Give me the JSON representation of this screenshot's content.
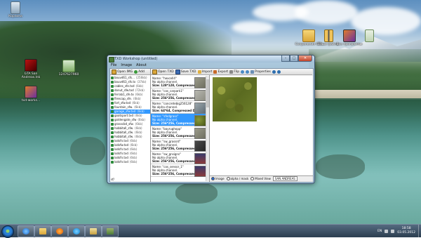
{
  "desktop": {
    "icons": [
      {
        "id": "recycle-bin",
        "label": "Корзина",
        "icon": "recycle-bin-icon"
      },
      {
        "id": "gta-sa",
        "label": "GTA San Andreas.lnk",
        "icon": "gta-icon"
      },
      {
        "id": "folder-1",
        "label": "1247627960",
        "icon": "image-file-icon"
      },
      {
        "id": "txd-works",
        "label": "txd-works...",
        "icon": "app-icon"
      },
      {
        "id": "rar-1",
        "label": "Сохранения GTA",
        "icon": "folder-icon"
      },
      {
        "id": "rar-2",
        "label": "Ваши файлы",
        "icon": "zip-icon"
      },
      {
        "id": "tool-1",
        "label": "Все программы",
        "icon": "tools-icon"
      },
      {
        "id": "doc-1",
        "label": "",
        "icon": "document-icon"
      }
    ]
  },
  "window": {
    "title": "TXD Workshop (untitled)",
    "menu": [
      "File",
      "Image",
      "About"
    ],
    "file_toolbar": {
      "open": "Open IMG",
      "add": "Add"
    },
    "tex_toolbar": {
      "open": "Open TXD",
      "save": "Save TXD",
      "import": "Import",
      "export": "Export",
      "flip": "Flip",
      "properties": "Properties"
    },
    "files": [
      {
        "name": "bouvd61_sfs...",
        "size": "(256kb)"
      },
      {
        "name": "bouvd63_sfs.tx",
        "size": "(37kb)"
      },
      {
        "name": "cables_sfe.txd",
        "size": "(6kb)"
      },
      {
        "name": "donut_sfw.txd",
        "size": "(72kb)"
      },
      {
        "name": "ferrab1_sfe.tx",
        "size": "(6kb)"
      },
      {
        "name": "firescap_sfe.",
        "size": "(6kb)"
      },
      {
        "name": "fort_sfw.txd",
        "size": "(6kb)"
      },
      {
        "name": "fountain_sfw.",
        "size": "(6kb)"
      },
      {
        "name": "garage_sfw.txd",
        "size": "(6kb)"
      },
      {
        "name": "goatsport.txd",
        "size": "(6kb)"
      },
      {
        "name": "goldengate_sfw",
        "size": "(6kb)"
      },
      {
        "name": "grasscbd_sfw.",
        "size": "(6kb)"
      },
      {
        "name": "hobbitall_sfw.",
        "size": "(6kb)"
      },
      {
        "name": "hobbitall_sfw.",
        "size": "(6kb)"
      },
      {
        "name": "hobbitall_sfw.",
        "size": "(6kb)"
      },
      {
        "name": "lodsfn.txd",
        "size": "(6kb)"
      },
      {
        "name": "lodsfw.txd",
        "size": "(6kb)"
      },
      {
        "name": "lodsfn.txd",
        "size": "(6kb)"
      },
      {
        "name": "lodsfn.txd",
        "size": "(6kb)"
      },
      {
        "name": "lodsfn.txd",
        "size": "(6kb)"
      },
      {
        "name": "lodsfn.txd",
        "size": "(6kb)"
      }
    ],
    "selected_file_index": 8,
    "status_left": "sf/",
    "textures": [
      {
        "name": "Name: \"hexcell4\"",
        "alpha": "No alpha channel.",
        "size": "Size: 128*128, Compressed",
        "thumb": "stone"
      },
      {
        "name": "Name: \"cos_carpark1\"",
        "alpha": "No alpha channel.",
        "size": "Size: 256*256, Compressed",
        "thumb": "light"
      },
      {
        "name": "Name: \"concretebig256128\"",
        "alpha": "No alpha channel.",
        "size": "Size: 64*64, Compressed DX",
        "thumb": "grey"
      },
      {
        "name": "Name: \"sfedgrass\"",
        "alpha": "No alpha channel.",
        "size": "Size: 256*256, Compressed",
        "thumb": "grass"
      },
      {
        "name": "Name: \"bayrughopp\"",
        "alpha": "No alpha channel.",
        "size": "Size: 256*256, Compressed",
        "thumb": "stone"
      },
      {
        "name": "Name: \"sw_grassrd\"",
        "alpha": "No alpha channel.",
        "size": "Size: 256*256, Compressed",
        "thumb": "dark"
      },
      {
        "name": "Name: \"sw_gnsigns\"",
        "alpha": "No alpha channel.",
        "size": "Size: 256*256, Compressed",
        "thumb": "pic"
      },
      {
        "name": "Name: \"cos_sensor_1\"",
        "alpha": "No alpha channel.",
        "size": "Size: 256*256, Compressed",
        "thumb": "pic"
      }
    ],
    "selected_texture_index": 3,
    "view_options": {
      "image": "Image",
      "alpha": "alpha / mask",
      "mixed": "Mixed View",
      "combo": "SAN ANDREAS"
    }
  },
  "taskbar": {
    "apps": [
      "Internet Explorer",
      "Windows Explorer",
      "Media Player",
      "Skype",
      "Folder",
      "TXD Workshop"
    ],
    "lang": "EN",
    "time": "18:58",
    "date": "03.05.2012"
  }
}
